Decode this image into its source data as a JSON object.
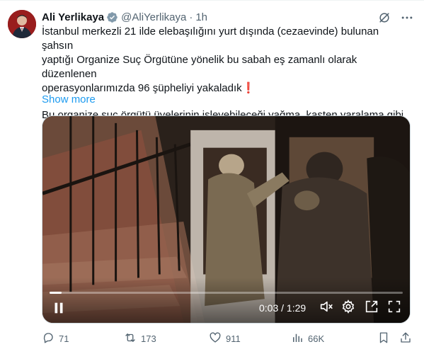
{
  "tweet": {
    "author_name": "Ali Yerlikaya",
    "handle": "@AliYerlikaya",
    "separator": "·",
    "time": "1h",
    "text_lines": [
      "İstanbul merkezli 21 ilde elebaşılığını yurt dışında (cezaevinde) bulunan şahsın",
      "yaptığı Organize Suç Örgütüne yönelik bu sabah eş zamanlı olarak düzenlenen",
      "operasyonlarımızda 96 şüpheliyi yakaladık❗"
    ],
    "text_line_2": "Bu organize suç örgütü üyelerinin  işleyebileceği yağma, kasten yaralama gibi",
    "show_more": "Show more"
  },
  "video": {
    "current_time": "0:03",
    "time_separator": " / ",
    "duration": "1:29",
    "progress": 0.034
  },
  "actions": {
    "replies": "71",
    "reposts": "173",
    "likes": "911",
    "views": "66K"
  },
  "icons": {
    "verified": "verified-badge-icon",
    "grok": "grok-icon",
    "more": "more-icon",
    "pause": "pause-icon",
    "mute": "mute-icon",
    "settings": "settings-icon",
    "pip": "picture-in-picture-icon",
    "fullscreen": "fullscreen-icon",
    "reply": "reply-icon",
    "repost": "repost-icon",
    "like": "like-icon",
    "views": "views-icon",
    "bookmark": "bookmark-icon",
    "share": "share-icon"
  },
  "colors": {
    "accent": "#1d9bf0",
    "text_primary": "#0f1419",
    "text_secondary": "#536471",
    "verified": "#829aab"
  }
}
